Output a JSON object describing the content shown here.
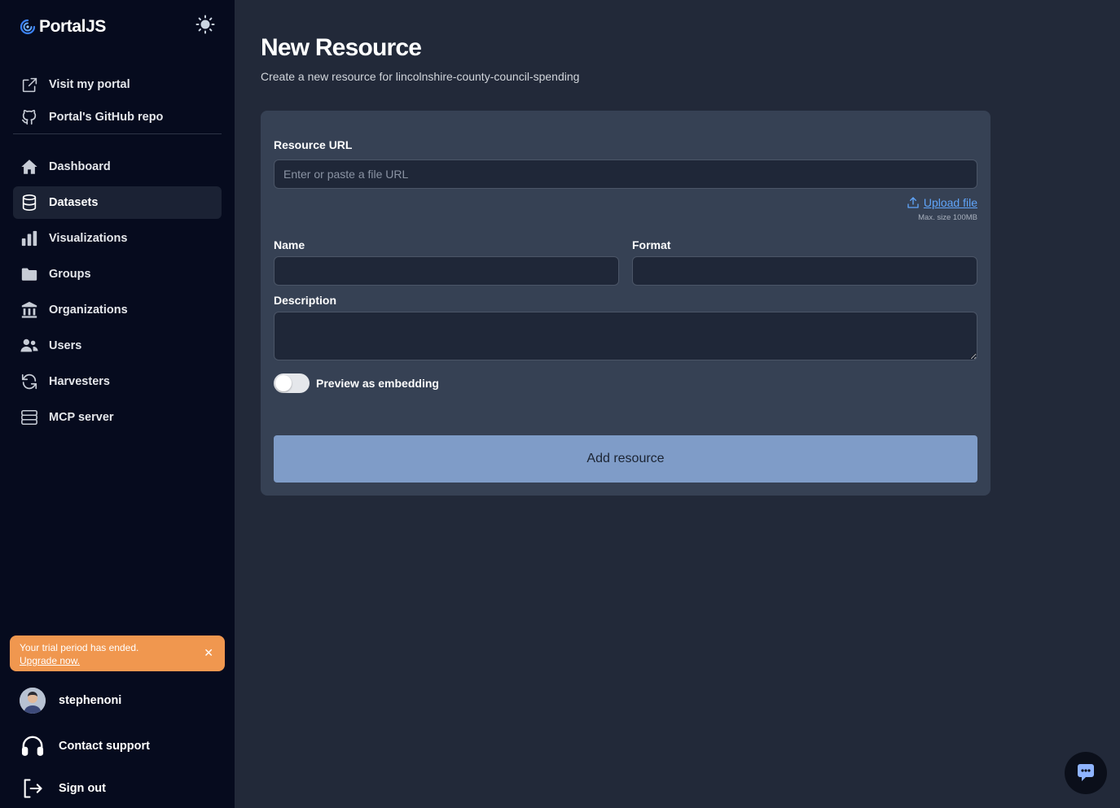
{
  "app": {
    "name": "PortalJS"
  },
  "sidebar": {
    "links": [
      {
        "label": "Visit my portal",
        "icon": "external-link-icon"
      },
      {
        "label": "Portal's GitHub repo",
        "icon": "github-icon"
      }
    ],
    "items": [
      {
        "label": "Dashboard",
        "icon": "home-icon"
      },
      {
        "label": "Datasets",
        "icon": "database-icon",
        "active": true
      },
      {
        "label": "Visualizations",
        "icon": "bar-chart-icon"
      },
      {
        "label": "Groups",
        "icon": "folder-icon"
      },
      {
        "label": "Organizations",
        "icon": "building-icon"
      },
      {
        "label": "Users",
        "icon": "users-icon"
      },
      {
        "label": "Harvesters",
        "icon": "refresh-icon"
      },
      {
        "label": "MCP server",
        "icon": "server-icon"
      }
    ],
    "trial": {
      "text": "Your trial period has ended.",
      "link": "Upgrade now."
    },
    "user": {
      "name": "stephenoni"
    },
    "support_label": "Contact support",
    "signout_label": "Sign out"
  },
  "page": {
    "title": "New Resource",
    "subtitle": "Create a new resource for lincolnshire-county-council-spending"
  },
  "form": {
    "resource_url_label": "Resource URL",
    "resource_url_placeholder": "Enter or paste a file URL",
    "resource_url_value": "",
    "upload_label": "Upload file",
    "max_size": "Max. size 100MB",
    "name_label": "Name",
    "name_value": "",
    "format_label": "Format",
    "format_value": "",
    "description_label": "Description",
    "description_value": "",
    "preview_label": "Preview as embedding",
    "preview_enabled": false,
    "submit_label": "Add resource"
  },
  "colors": {
    "sidebar_bg": "#060b1e",
    "main_bg": "#222939",
    "card_bg": "#364154",
    "accent": "#60a5fa",
    "button": "#7f9cc8",
    "trial_banner": "#f0974f"
  }
}
